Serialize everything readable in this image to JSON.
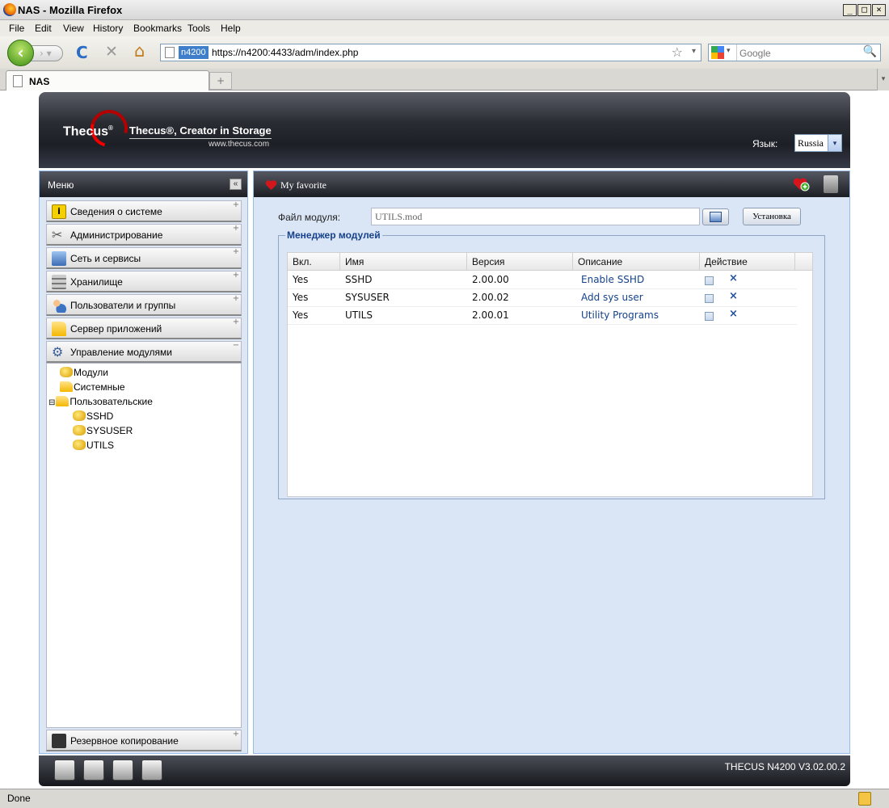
{
  "window": {
    "title": "NAS - Mozilla Firefox",
    "min": "_",
    "max": "□",
    "close": "×"
  },
  "menubar": [
    "File",
    "Edit",
    "View",
    "History",
    "Bookmarks",
    "Tools",
    "Help"
  ],
  "nav": {
    "site_badge": "n4200",
    "url": "https://n4200:4433/adm/index.php",
    "search_placeholder": "Google",
    "back_glyph": "‹",
    "fwd_glyph": "› ▾",
    "reload_glyph": "C",
    "stop_glyph": "✕",
    "home_glyph": "⌂",
    "star_glyph": "☆",
    "drop_glyph": "▾",
    "search_glyph": "🔍"
  },
  "tabs": [
    {
      "label": "NAS"
    }
  ],
  "newtab_glyph": "+",
  "tab_scroll": "▾",
  "header": {
    "logo": "Thecus",
    "logo_sup": "®",
    "tagline": "Thecus®, Creator in Storage",
    "site": "www.thecus.com",
    "lang_label": "Язык:",
    "lang_value": "Russia",
    "lang_drop": "▾"
  },
  "menu": {
    "title": "Меню",
    "collapse_glyph": "«",
    "items": [
      {
        "label": "Сведения о системе",
        "pm": "+"
      },
      {
        "label": "Администрирование",
        "pm": "+"
      },
      {
        "label": "Сеть и сервисы",
        "pm": "+"
      },
      {
        "label": "Хранилище",
        "pm": "+"
      },
      {
        "label": "Пользователи и группы",
        "pm": "+"
      },
      {
        "label": "Сервер приложений",
        "pm": "+"
      },
      {
        "label": "Управление модулями",
        "pm": "−"
      }
    ],
    "tree": {
      "modules": "Модули",
      "system": "Системные",
      "user": "Пользовательские",
      "user_toggle": "⊟",
      "children": [
        "SSHD",
        "SYSUSER",
        "UTILS"
      ]
    },
    "bottom_item": {
      "label": "Резервное копирование",
      "pm": "+"
    }
  },
  "main": {
    "favorite_title": "My favorite",
    "file_label": "Файл модуля:",
    "file_value": "UTILS.mod",
    "install_label": "Установка",
    "manager_legend": "Менеджер модулей",
    "columns": [
      "Вкл.",
      "Имя",
      "Версия",
      "Описание",
      "Действие"
    ],
    "delete_glyph": "×",
    "rows": [
      {
        "enabled": "Yes",
        "name": "SSHD",
        "version": "2.00.00",
        "description": "Enable SSHD"
      },
      {
        "enabled": "Yes",
        "name": "SYSUSER",
        "version": "2.00.02",
        "description": "Add sys user"
      },
      {
        "enabled": "Yes",
        "name": "UTILS",
        "version": "2.00.01",
        "description": "Utility Programs"
      }
    ]
  },
  "footer": {
    "version": "THECUS N4200 V3.02.00.2"
  },
  "status": {
    "text": "Done"
  }
}
